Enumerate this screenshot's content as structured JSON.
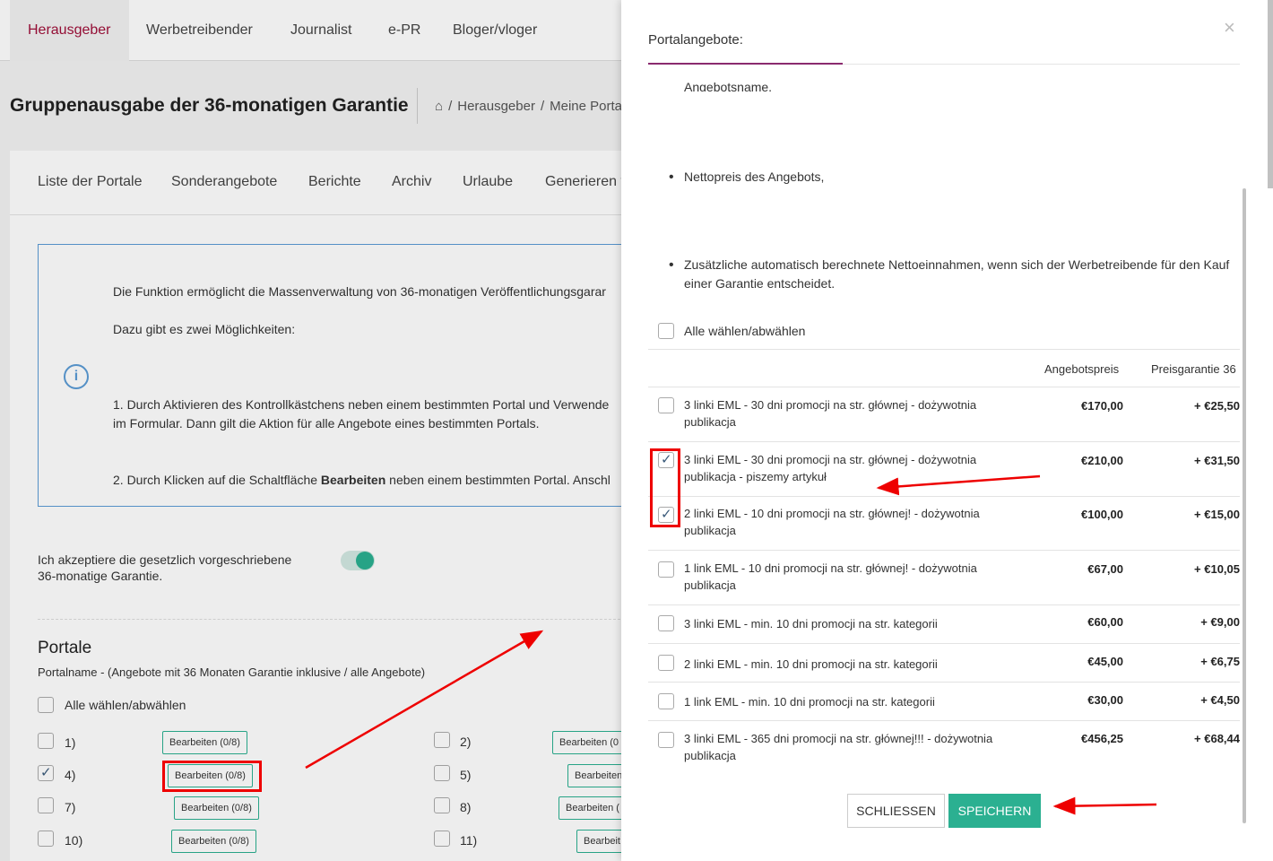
{
  "topnav": {
    "tabs": [
      "Herausgeber",
      "Werbetreibender",
      "Journalist",
      "e-PR",
      "Bloger/vloger"
    ]
  },
  "page": {
    "title": "Gruppenausgabe der 36-monatigen Garantie",
    "breadcrumb": [
      "Herausgeber",
      "Meine Porta"
    ]
  },
  "subtabs": [
    "Liste der Portale",
    "Sonderangebote",
    "Berichte",
    "Archiv",
    "Urlaube",
    "Generieren v"
  ],
  "info": {
    "line1": "Die Funktion ermöglicht die Massenverwaltung von 36-monatigen Veröffentlichungsgarar",
    "line2": "Dazu gibt es zwei Möglichkeiten:",
    "line3": "1. Durch Aktivieren des Kontrollkästchens neben einem bestimmten Portal und Verwende",
    "line4": "im Formular. Dann gilt die Aktion für alle Angebote eines bestimmten Portals.",
    "line5_pre": "2. Durch Klicken auf die Schaltfläche ",
    "line5_bold": "Bearbeiten",
    "line5_post": " neben einem bestimmten Portal. Anschl"
  },
  "toggle": {
    "label_line1": "Ich akzeptiere die gesetzlich vorgeschriebene",
    "label_line2": "36-monatige Garantie."
  },
  "portale": {
    "title": "Portale",
    "subtitle": "Portalname - (Angebote mit 36 Monaten Garantie inklusive / alle Angebote)",
    "select_all": "Alle wählen/abwählen",
    "items_left": [
      {
        "num": "1)",
        "btn": "Bearbeiten (0/8)",
        "checked": false
      },
      {
        "num": "4)",
        "btn": "Bearbeiten (0/8)",
        "checked": true
      },
      {
        "num": "7)",
        "btn": "Bearbeiten (0/8)",
        "checked": false
      },
      {
        "num": "10)",
        "btn": "Bearbeiten (0/8)",
        "checked": false
      }
    ],
    "items_right": [
      {
        "num": "2)",
        "btn": "Bearbeiten (0",
        "checked": false
      },
      {
        "num": "5)",
        "btn": "Bearbeiten",
        "checked": false
      },
      {
        "num": "8)",
        "btn": "Bearbeiten (",
        "checked": false
      },
      {
        "num": "11)",
        "btn": "Bearbeit",
        "checked": false
      }
    ]
  },
  "panel": {
    "title": "Portalangebote:",
    "close_glyph": "×",
    "cut_text": "Angebotsname,",
    "bullets": [
      "Nettopreis des Angebots,",
      "Zusätzliche automatisch berechnete Nettoeinnahmen, wenn sich der Werbetreibende für den Kauf einer Garantie entscheidet."
    ],
    "select_all": "Alle wählen/abwählen",
    "col_price": "Angebotspreis",
    "col_guarantee": "Preisgarantie 36",
    "offers": [
      {
        "name": "3 linki EML - 30 dni promocji na str. głównej - dożywotnia publikacja",
        "price": "€170,00",
        "guarantee": "+ €25,50",
        "checked": false
      },
      {
        "name": "3 linki EML - 30 dni promocji na str. głównej - dożywotnia publikacja - piszemy artykuł",
        "price": "€210,00",
        "guarantee": "+ €31,50",
        "checked": true
      },
      {
        "name": "2 linki EML - 10 dni promocji na str. głównej! - dożywotnia publikacja",
        "price": "€100,00",
        "guarantee": "+ €15,00",
        "checked": true
      },
      {
        "name": "1 link EML - 10 dni promocji na str. głównej! - dożywotnia publikacja",
        "price": "€67,00",
        "guarantee": "+ €10,05",
        "checked": false
      },
      {
        "name": "3 linki EML - min. 10 dni promocji na str. kategorii",
        "price": "€60,00",
        "guarantee": "+ €9,00",
        "checked": false
      },
      {
        "name": "2 linki EML - min. 10 dni promocji na str. kategorii",
        "price": "€45,00",
        "guarantee": "+ €6,75",
        "checked": false
      },
      {
        "name": "1 link EML - min. 10 dni promocji na str. kategorii",
        "price": "€30,00",
        "guarantee": "+ €4,50",
        "checked": false
      },
      {
        "name": "3 linki EML - 365 dni promocji na str. głównej!!! - dożywotnia publikacja",
        "price": "€456,25",
        "guarantee": "+ €68,44",
        "checked": false
      }
    ],
    "btn_close": "SCHLIESSEN",
    "btn_save": "SPEICHERN"
  },
  "colors": {
    "brand": "#a0103a",
    "accent_green": "#2bb091",
    "info_blue": "#5b9bd5",
    "annotation_red": "#ee0000"
  }
}
